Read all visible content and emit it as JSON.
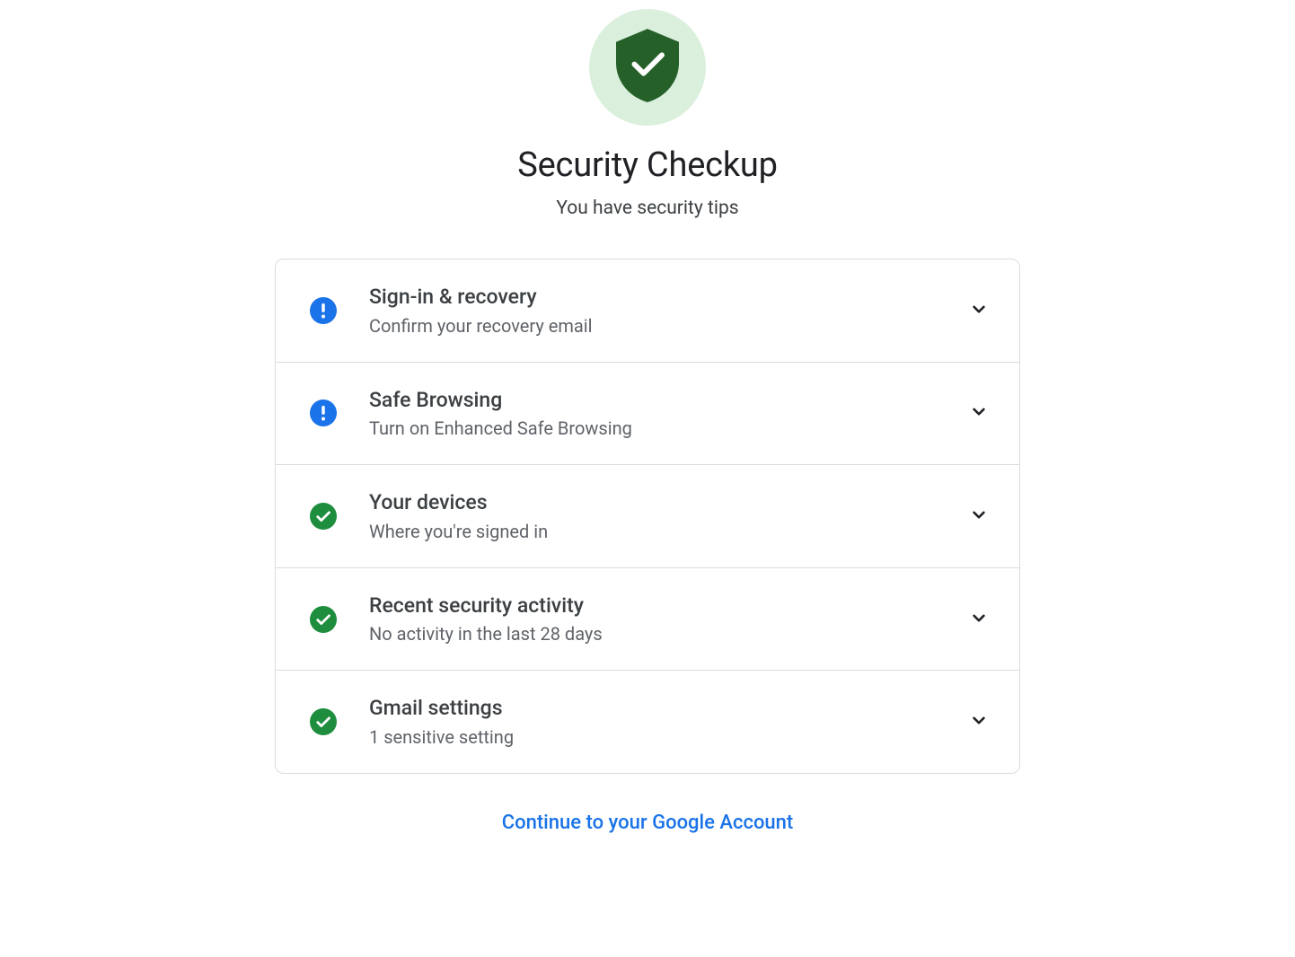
{
  "header": {
    "title": "Security Checkup",
    "subtitle": "You have security tips"
  },
  "items": [
    {
      "status": "info",
      "title": "Sign-in & recovery",
      "desc": "Confirm your recovery email"
    },
    {
      "status": "info",
      "title": "Safe Browsing",
      "desc": "Turn on Enhanced Safe Browsing"
    },
    {
      "status": "ok",
      "title": "Your devices",
      "desc": "Where you're signed in"
    },
    {
      "status": "ok",
      "title": "Recent security activity",
      "desc": "No activity in the last 28 days"
    },
    {
      "status": "ok",
      "title": "Gmail settings",
      "desc": "1 sensitive setting"
    }
  ],
  "footer": {
    "continue_label": "Continue to your Google Account"
  },
  "colors": {
    "info": "#1a73e8",
    "ok": "#1e8e3e",
    "hero_shield": "#256029",
    "hero_bg": "#dbf0dc"
  }
}
